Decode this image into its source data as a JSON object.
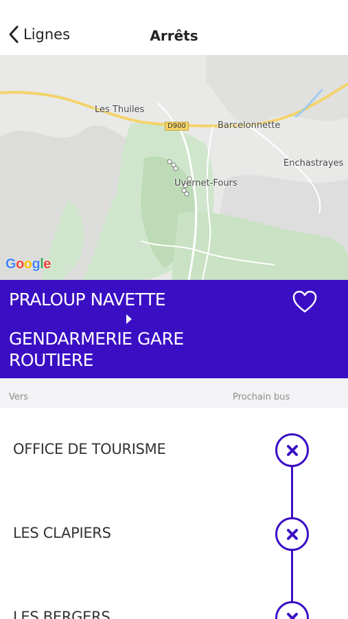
{
  "nav": {
    "back_label": "Lignes",
    "title": "Arrêts"
  },
  "map": {
    "labels": {
      "les_thuiles": "Les Thuiles",
      "barcelonnette": "Barcelonnette",
      "enchastrayes": "Enchastrayes",
      "uvernet_fours": "Uvernet-Fours",
      "road": "D900"
    },
    "attribution": "Google"
  },
  "route": {
    "from": "PRALOUP NAVETTE",
    "to": "GENDARMERIE GARE ROUTIERE",
    "favorite_icon": "heart-outline-icon"
  },
  "columns": {
    "vers": "Vers",
    "next_bus": "Prochain bus"
  },
  "stops": [
    {
      "name": "OFFICE DE TOURISME"
    },
    {
      "name": "LES CLAPIERS"
    },
    {
      "name": "LES BERGERS"
    }
  ],
  "colors": {
    "accent": "#3a0fc4",
    "header_bg": "#f3f3f6"
  }
}
